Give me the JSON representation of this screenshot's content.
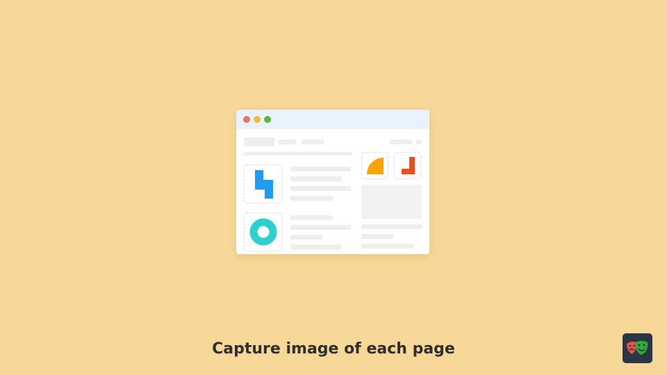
{
  "caption": "Capture image of each page",
  "window": {
    "traffic_lights": [
      "red",
      "yellow",
      "green"
    ],
    "icons": [
      "blue-step-shape-icon",
      "teal-ring-icon",
      "orange-quarter-circle-icon",
      "red-l-shape-icon"
    ]
  },
  "brand": {
    "logo": "playwright-masks-icon"
  },
  "colors": {
    "background": "#f8d898",
    "titlebar": "#e8f3fd",
    "blue": "#1f9bf0",
    "teal": "#2ecfcf",
    "orange": "#f9a400",
    "red": "#f14a1c",
    "logo_bg": "#2d3446"
  }
}
